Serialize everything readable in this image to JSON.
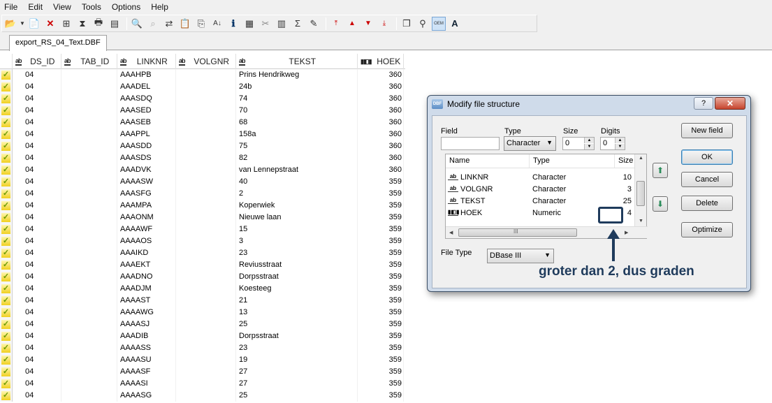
{
  "menu": [
    "File",
    "Edit",
    "View",
    "Tools",
    "Options",
    "Help"
  ],
  "toolbar_icons": [
    "open-folder-icon",
    "dropdown-arrow-icon",
    "new-document-icon",
    "delete-x-icon",
    "structure-icon",
    "filter-icon",
    "print-icon",
    "print-preview-icon",
    "find-icon",
    "find-next-icon",
    "replace-icon",
    "paste-icon",
    "copy-icon",
    "sort-icon",
    "info-icon",
    "calculator-icon",
    "pin-icon",
    "grid-icon",
    "sigma-icon",
    "clear-icon",
    "move-first-icon",
    "move-up-icon",
    "move-down-icon",
    "move-last-icon",
    "windows-icon",
    "search-icon",
    "oem-icon",
    "font-icon"
  ],
  "tab": {
    "label": "export_RS_04_Text.DBF"
  },
  "grid": {
    "headers": [
      "DS_ID",
      "TAB_ID",
      "LINKNR",
      "VOLGNR",
      "TEKST",
      "HOEK"
    ],
    "rows": [
      [
        "04",
        "",
        "AAAHPB",
        "",
        "Prins Hendrikweg",
        "360"
      ],
      [
        "04",
        "",
        "AAADEL",
        "",
        "24b",
        "360"
      ],
      [
        "04",
        "",
        "AAASDQ",
        "",
        "74",
        "360"
      ],
      [
        "04",
        "",
        "AAASED",
        "",
        "70",
        "360"
      ],
      [
        "04",
        "",
        "AAASEB",
        "",
        "68",
        "360"
      ],
      [
        "04",
        "",
        "AAAPPL",
        "",
        "158a",
        "360"
      ],
      [
        "04",
        "",
        "AAASDD",
        "",
        "75",
        "360"
      ],
      [
        "04",
        "",
        "AAASDS",
        "",
        "82",
        "360"
      ],
      [
        "04",
        "",
        "AAADVK",
        "",
        "van  Lennepstraat",
        "360"
      ],
      [
        "04",
        "",
        "AAAASW",
        "",
        "40",
        "359"
      ],
      [
        "04",
        "",
        "AAASFG",
        "",
        "2",
        "359"
      ],
      [
        "04",
        "",
        "AAAMPA",
        "",
        "Koperwiek",
        "359"
      ],
      [
        "04",
        "",
        "AAAONM",
        "",
        "Nieuwe laan",
        "359"
      ],
      [
        "04",
        "",
        "AAAAWF",
        "",
        "15",
        "359"
      ],
      [
        "04",
        "",
        "AAAAOS",
        "",
        "3",
        "359"
      ],
      [
        "04",
        "",
        "AAAIKD",
        "",
        "23",
        "359"
      ],
      [
        "04",
        "",
        "AAAEKT",
        "",
        "Reviusstraat",
        "359"
      ],
      [
        "04",
        "",
        "AAADNO",
        "",
        "Dorpsstraat",
        "359"
      ],
      [
        "04",
        "",
        "AAADJM",
        "",
        "Koesteeg",
        "359"
      ],
      [
        "04",
        "",
        "AAAAST",
        "",
        "21",
        "359"
      ],
      [
        "04",
        "",
        "AAAAWG",
        "",
        "13",
        "359"
      ],
      [
        "04",
        "",
        "AAAASJ",
        "",
        "25",
        "359"
      ],
      [
        "04",
        "",
        "AAADIB",
        "",
        "Dorpsstraat",
        "359"
      ],
      [
        "04",
        "",
        "AAAASS",
        "",
        "23",
        "359"
      ],
      [
        "04",
        "",
        "AAAASU",
        "",
        "19",
        "359"
      ],
      [
        "04",
        "",
        "AAAASF",
        "",
        "27",
        "359"
      ],
      [
        "04",
        "",
        "AAAASI",
        "",
        "27",
        "359"
      ],
      [
        "04",
        "",
        "AAAASG",
        "",
        "25",
        "359"
      ]
    ]
  },
  "dialog": {
    "title": "Modify file structure",
    "help_label": "?",
    "close_label": "✕",
    "field_label": "Field",
    "field_value": "",
    "type_label": "Type",
    "type_value": "Character",
    "size_label": "Size",
    "size_value": "0",
    "digits_label": "Digits",
    "digits_value": "0",
    "list_headers": [
      "Name",
      "Type",
      "Size"
    ],
    "list_rows": [
      {
        "name": "LINKNR",
        "type": "Character",
        "size": "10",
        "kind": "ab"
      },
      {
        "name": "VOLGNR",
        "type": "Character",
        "size": "3",
        "kind": "ab"
      },
      {
        "name": "TEKST",
        "type": "Character",
        "size": "25",
        "kind": "ab"
      },
      {
        "name": "HOEK",
        "type": "Numeric",
        "size": "4",
        "kind": "num"
      }
    ],
    "scroll_mark": "III",
    "file_type_label": "File Type",
    "file_type_value": "DBase III",
    "buttons": {
      "new_field": "New field",
      "ok": "OK",
      "cancel": "Cancel",
      "delete": "Delete",
      "optimize": "Optimize"
    }
  },
  "annotation": {
    "text": "groter dan 2, dus graden",
    "color": "#1f3b5c"
  }
}
